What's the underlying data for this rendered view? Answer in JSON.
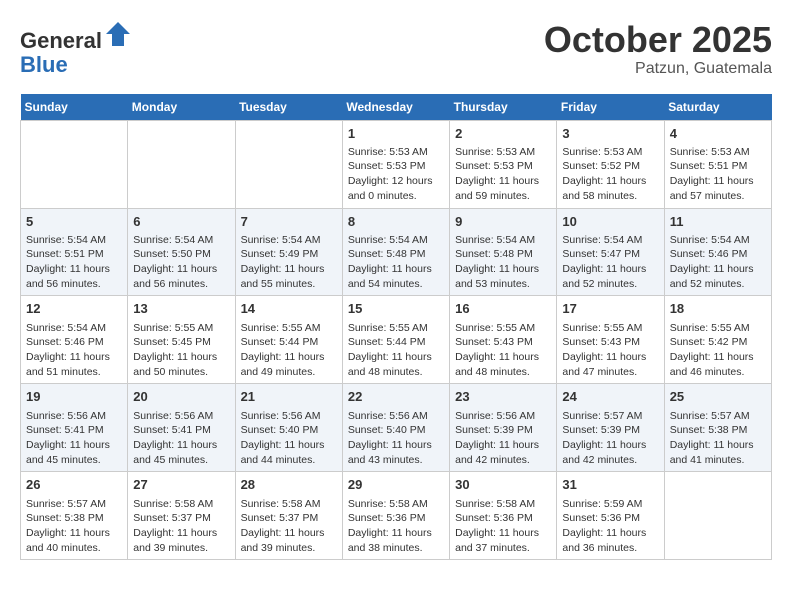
{
  "header": {
    "logo_line1": "General",
    "logo_line2": "Blue",
    "month": "October 2025",
    "location": "Patzun, Guatemala"
  },
  "weekdays": [
    "Sunday",
    "Monday",
    "Tuesday",
    "Wednesday",
    "Thursday",
    "Friday",
    "Saturday"
  ],
  "weeks": [
    [
      {
        "day": "",
        "info": ""
      },
      {
        "day": "",
        "info": ""
      },
      {
        "day": "",
        "info": ""
      },
      {
        "day": "1",
        "info": "Sunrise: 5:53 AM\nSunset: 5:53 PM\nDaylight: 12 hours\nand 0 minutes."
      },
      {
        "day": "2",
        "info": "Sunrise: 5:53 AM\nSunset: 5:53 PM\nDaylight: 11 hours\nand 59 minutes."
      },
      {
        "day": "3",
        "info": "Sunrise: 5:53 AM\nSunset: 5:52 PM\nDaylight: 11 hours\nand 58 minutes."
      },
      {
        "day": "4",
        "info": "Sunrise: 5:53 AM\nSunset: 5:51 PM\nDaylight: 11 hours\nand 57 minutes."
      }
    ],
    [
      {
        "day": "5",
        "info": "Sunrise: 5:54 AM\nSunset: 5:51 PM\nDaylight: 11 hours\nand 56 minutes."
      },
      {
        "day": "6",
        "info": "Sunrise: 5:54 AM\nSunset: 5:50 PM\nDaylight: 11 hours\nand 56 minutes."
      },
      {
        "day": "7",
        "info": "Sunrise: 5:54 AM\nSunset: 5:49 PM\nDaylight: 11 hours\nand 55 minutes."
      },
      {
        "day": "8",
        "info": "Sunrise: 5:54 AM\nSunset: 5:48 PM\nDaylight: 11 hours\nand 54 minutes."
      },
      {
        "day": "9",
        "info": "Sunrise: 5:54 AM\nSunset: 5:48 PM\nDaylight: 11 hours\nand 53 minutes."
      },
      {
        "day": "10",
        "info": "Sunrise: 5:54 AM\nSunset: 5:47 PM\nDaylight: 11 hours\nand 52 minutes."
      },
      {
        "day": "11",
        "info": "Sunrise: 5:54 AM\nSunset: 5:46 PM\nDaylight: 11 hours\nand 52 minutes."
      }
    ],
    [
      {
        "day": "12",
        "info": "Sunrise: 5:54 AM\nSunset: 5:46 PM\nDaylight: 11 hours\nand 51 minutes."
      },
      {
        "day": "13",
        "info": "Sunrise: 5:55 AM\nSunset: 5:45 PM\nDaylight: 11 hours\nand 50 minutes."
      },
      {
        "day": "14",
        "info": "Sunrise: 5:55 AM\nSunset: 5:44 PM\nDaylight: 11 hours\nand 49 minutes."
      },
      {
        "day": "15",
        "info": "Sunrise: 5:55 AM\nSunset: 5:44 PM\nDaylight: 11 hours\nand 48 minutes."
      },
      {
        "day": "16",
        "info": "Sunrise: 5:55 AM\nSunset: 5:43 PM\nDaylight: 11 hours\nand 48 minutes."
      },
      {
        "day": "17",
        "info": "Sunrise: 5:55 AM\nSunset: 5:43 PM\nDaylight: 11 hours\nand 47 minutes."
      },
      {
        "day": "18",
        "info": "Sunrise: 5:55 AM\nSunset: 5:42 PM\nDaylight: 11 hours\nand 46 minutes."
      }
    ],
    [
      {
        "day": "19",
        "info": "Sunrise: 5:56 AM\nSunset: 5:41 PM\nDaylight: 11 hours\nand 45 minutes."
      },
      {
        "day": "20",
        "info": "Sunrise: 5:56 AM\nSunset: 5:41 PM\nDaylight: 11 hours\nand 45 minutes."
      },
      {
        "day": "21",
        "info": "Sunrise: 5:56 AM\nSunset: 5:40 PM\nDaylight: 11 hours\nand 44 minutes."
      },
      {
        "day": "22",
        "info": "Sunrise: 5:56 AM\nSunset: 5:40 PM\nDaylight: 11 hours\nand 43 minutes."
      },
      {
        "day": "23",
        "info": "Sunrise: 5:56 AM\nSunset: 5:39 PM\nDaylight: 11 hours\nand 42 minutes."
      },
      {
        "day": "24",
        "info": "Sunrise: 5:57 AM\nSunset: 5:39 PM\nDaylight: 11 hours\nand 42 minutes."
      },
      {
        "day": "25",
        "info": "Sunrise: 5:57 AM\nSunset: 5:38 PM\nDaylight: 11 hours\nand 41 minutes."
      }
    ],
    [
      {
        "day": "26",
        "info": "Sunrise: 5:57 AM\nSunset: 5:38 PM\nDaylight: 11 hours\nand 40 minutes."
      },
      {
        "day": "27",
        "info": "Sunrise: 5:58 AM\nSunset: 5:37 PM\nDaylight: 11 hours\nand 39 minutes."
      },
      {
        "day": "28",
        "info": "Sunrise: 5:58 AM\nSunset: 5:37 PM\nDaylight: 11 hours\nand 39 minutes."
      },
      {
        "day": "29",
        "info": "Sunrise: 5:58 AM\nSunset: 5:36 PM\nDaylight: 11 hours\nand 38 minutes."
      },
      {
        "day": "30",
        "info": "Sunrise: 5:58 AM\nSunset: 5:36 PM\nDaylight: 11 hours\nand 37 minutes."
      },
      {
        "day": "31",
        "info": "Sunrise: 5:59 AM\nSunset: 5:36 PM\nDaylight: 11 hours\nand 36 minutes."
      },
      {
        "day": "",
        "info": ""
      }
    ]
  ]
}
